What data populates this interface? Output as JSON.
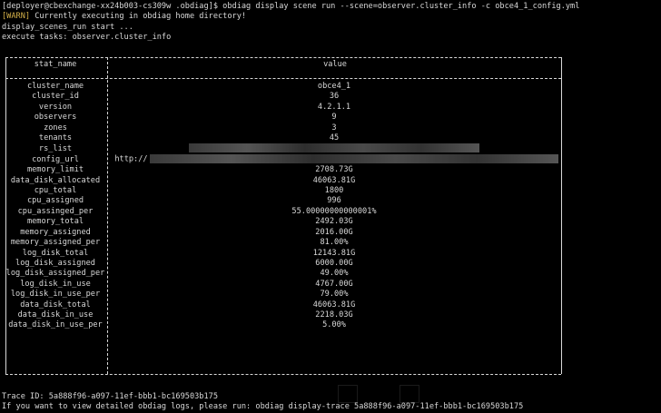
{
  "terminal": {
    "prompt_line": "[deployer@cbexchange-xx24b003-cs309w .obdiag]$ obdiag display scene run --scene=observer.cluster_info -c obce4_1_config.yml",
    "warn_tag": "[WARN]",
    "warn_text": " Currently executing in obdiag home directory!",
    "start_line": "display_scenes_run start ...",
    "exec_line": "execute tasks: observer.cluster_info"
  },
  "table": {
    "headers": {
      "name": "stat_name",
      "value": "value"
    },
    "rows": [
      {
        "name": "cluster_name",
        "value": "obce4_1"
      },
      {
        "name": "cluster_id",
        "value": "36"
      },
      {
        "name": "version",
        "value": "4.2.1.1"
      },
      {
        "name": "observers",
        "value": "9"
      },
      {
        "name": "zones",
        "value": "3"
      },
      {
        "name": "tenants",
        "value": "45"
      },
      {
        "name": "rs_list",
        "value": ""
      },
      {
        "name": "config_url",
        "value": "http://"
      },
      {
        "name": "memory_limit",
        "value": "2708.73G"
      },
      {
        "name": "data_disk_allocated",
        "value": "46063.81G"
      },
      {
        "name": "cpu_total",
        "value": "1800"
      },
      {
        "name": "cpu_assigned",
        "value": "996"
      },
      {
        "name": "cpu_assinged_per",
        "value": "55.00000000000001%"
      },
      {
        "name": "memory_total",
        "value": "2492.03G"
      },
      {
        "name": "memory_assigned",
        "value": "2016.00G"
      },
      {
        "name": "memory_assigned_per",
        "value": "81.00%"
      },
      {
        "name": "log_disk_total",
        "value": "12143.81G"
      },
      {
        "name": "log_disk_assigned",
        "value": "6000.00G"
      },
      {
        "name": "log_disk_assigned_per",
        "value": "49.00%"
      },
      {
        "name": "log_disk_in_use",
        "value": "4767.00G"
      },
      {
        "name": "log_disk_in_use_per",
        "value": "79.00%"
      },
      {
        "name": "data_disk_total",
        "value": "46063.81G"
      },
      {
        "name": "data_disk_in_use",
        "value": "2218.03G"
      },
      {
        "name": "data_disk_in_use_per",
        "value": "5.00%"
      }
    ]
  },
  "footer": {
    "trace_line": "Trace ID: 5a888f96-a097-11ef-bbb1-bc169503b175",
    "help_line": "If you want to view detailed obdiag logs, please run: obdiag display-trace 5a888f96-a097-11ef-bbb1-bc169503b175"
  },
  "colors": {
    "background": "#000000",
    "text": "#d8d8d8",
    "warn": "#d6b24a"
  }
}
